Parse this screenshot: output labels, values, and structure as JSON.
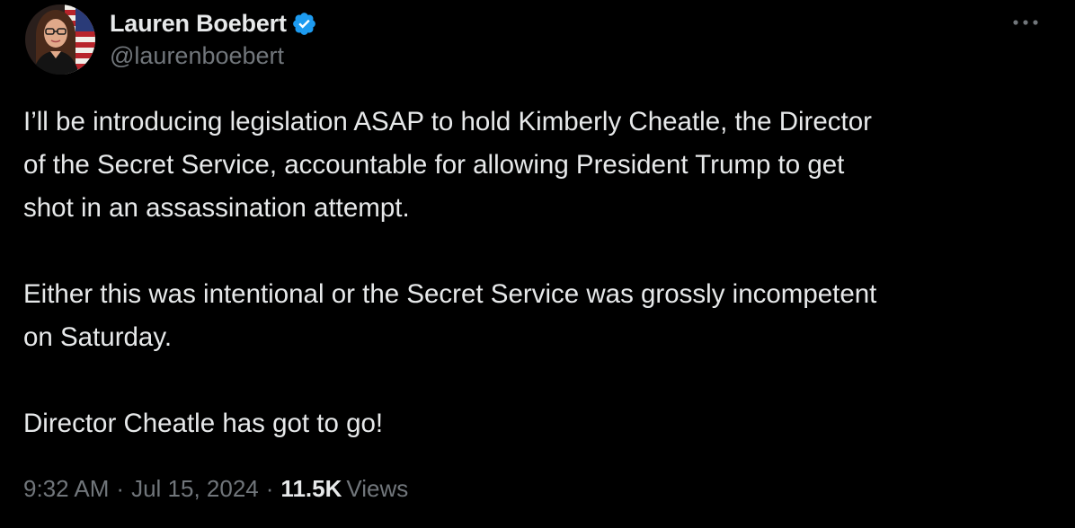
{
  "author": {
    "display_name": "Lauren Boebert",
    "handle": "@laurenboebert",
    "verified": true,
    "verified_color": "#1d9bf0",
    "avatar_icon": "profile-photo"
  },
  "more_icon": "ellipsis-icon",
  "tweet": {
    "paragraphs": [
      "I’ll be introducing legislation ASAP to hold Kimberly Cheatle, the Director\nof the Secret Service, accountable for allowing President Trump to get\nshot in an assassination attempt.",
      "Either this was intentional or the Secret Service was grossly incompetent\non Saturday.",
      "Director Cheatle has got to go!"
    ]
  },
  "meta": {
    "time": "9:32 AM",
    "separator": "·",
    "date": "Jul 15, 2024",
    "views_count": "11.5K",
    "views_label": "Views"
  },
  "colors": {
    "background": "#000000",
    "primary_text": "#e7e9ea",
    "secondary_text": "#71767b"
  }
}
